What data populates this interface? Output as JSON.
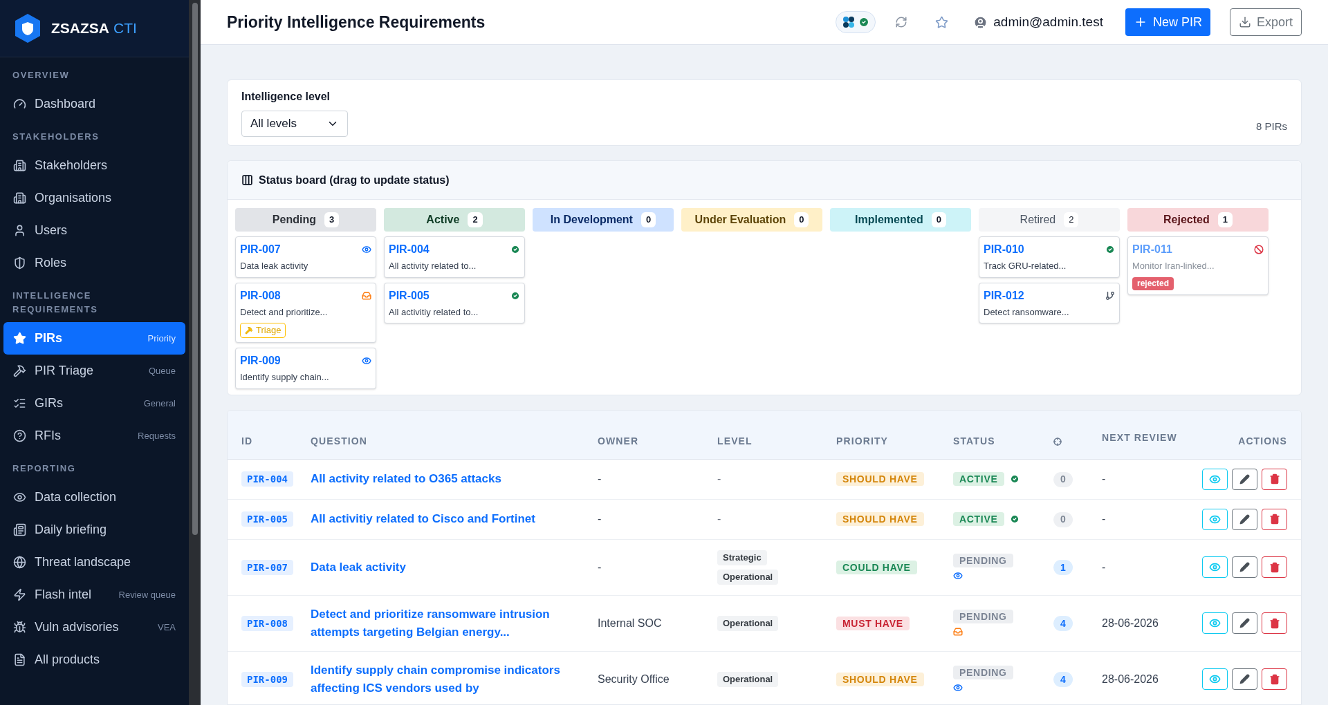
{
  "sidebar": {
    "brand": {
      "name": "ZSAZSA",
      "suffix": "CTI"
    },
    "sections": [
      {
        "title": "OVERVIEW",
        "items": [
          {
            "label": "Dashboard",
            "kind": "gauge",
            "selected": false
          }
        ]
      },
      {
        "title": "STAKEHOLDERS",
        "items": [
          {
            "label": "Stakeholders",
            "kind": "building",
            "selected": false
          },
          {
            "label": "Organisations",
            "kind": "building",
            "selected": false
          },
          {
            "label": "Users",
            "kind": "user",
            "selected": false
          },
          {
            "label": "Roles",
            "kind": "shield",
            "selected": false
          }
        ]
      },
      {
        "title": "INTELLIGENCE REQUIREMENTS",
        "items": [
          {
            "label": "PIRs",
            "hint": "Priority",
            "kind": "star",
            "selected": true
          },
          {
            "label": "PIR Triage",
            "hint": "Queue",
            "kind": "hammer",
            "selected": false
          },
          {
            "label": "GIRs",
            "hint": "General",
            "kind": "list",
            "selected": false
          },
          {
            "label": "RFIs",
            "hint": "Requests",
            "kind": "help",
            "selected": false
          }
        ]
      },
      {
        "title": "REPORTING",
        "items": [
          {
            "label": "Data collection",
            "kind": "eye",
            "selected": false
          },
          {
            "label": "Daily briefing",
            "kind": "news",
            "selected": false
          },
          {
            "label": "Threat landscape",
            "kind": "globe",
            "selected": false
          },
          {
            "label": "Flash intel",
            "hint": "Review queue",
            "kind": "zap",
            "selected": false
          },
          {
            "label": "Vuln advisories",
            "hint": "VEA",
            "kind": "bug",
            "selected": false
          },
          {
            "label": "All products",
            "kind": "file",
            "selected": false
          }
        ]
      }
    ]
  },
  "header": {
    "title": "Priority Intelligence Requirements",
    "user": "admin@admin.test",
    "buttons": [
      {
        "label": "New PIR",
        "kind": "primary"
      },
      {
        "label": "Export",
        "kind": "outline"
      }
    ]
  },
  "filter": {
    "label": "Intelligence level",
    "value": "All levels",
    "count": "8 PIRs"
  },
  "board": {
    "title": "Status board (drag to update status)",
    "columns": [
      {
        "title": "Pending",
        "count": "3",
        "kind": "pending",
        "cards": [
          {
            "id": "PIR-007",
            "text": "Data leak activity",
            "kind": "eye"
          },
          {
            "id": "PIR-008",
            "text": "Detect and prioritize...",
            "kind": "inbox",
            "tag": {
              "label": "Triage",
              "kind": "triage"
            }
          },
          {
            "id": "PIR-009",
            "text": "Identify supply chain...",
            "kind": "eye"
          }
        ]
      },
      {
        "title": "Active",
        "count": "2",
        "kind": "active",
        "cards": [
          {
            "id": "PIR-004",
            "text": "All activity related to...",
            "kind": "check"
          },
          {
            "id": "PIR-005",
            "text": "All activitiy related to...",
            "kind": "check"
          }
        ]
      },
      {
        "title": "In Development",
        "count": "0",
        "kind": "development"
      },
      {
        "title": "Under Evaluation",
        "count": "0",
        "kind": "evaluation"
      },
      {
        "title": "Implemented",
        "count": "0",
        "kind": "implemented"
      },
      {
        "title": "Retired",
        "count": "2",
        "kind": "retired",
        "cards": [
          {
            "id": "PIR-010",
            "text": "Track GRU-related...",
            "kind": "check"
          },
          {
            "id": "PIR-012",
            "text": "Detect ransomware...",
            "kind": "branch"
          }
        ]
      },
      {
        "title": "Rejected",
        "count": "1",
        "kind": "rejected",
        "cards": [
          {
            "id": "PIR-011",
            "text": "Monitor Iran-linked...",
            "kind": "ban",
            "faded": true,
            "tag": {
              "label": "rejected",
              "kind": "rejected"
            }
          }
        ]
      }
    ]
  },
  "table": {
    "columns": [
      "ID",
      "QUESTION",
      "OWNER",
      "LEVEL",
      "PRIORITY",
      "STATUS",
      "NEXT REVIEW",
      "ACTIONS"
    ],
    "rows": [
      {
        "kind": "check",
        "id": "PIR-004",
        "question": "All activity related to O365 attacks",
        "owner": "-",
        "level_empty": "-",
        "priority": {
          "label": "SHOULD HAVE",
          "kind": "should"
        },
        "status": {
          "label": "ACTIVE",
          "kind": "active"
        },
        "count": "0",
        "next_review": "-"
      },
      {
        "kind": "check",
        "id": "PIR-005",
        "question": "All activitiy related to Cisco and Fortinet",
        "owner": "-",
        "level_empty": "-",
        "priority": {
          "label": "SHOULD HAVE",
          "kind": "should"
        },
        "status": {
          "label": "ACTIVE",
          "kind": "active"
        },
        "count": "0",
        "next_review": "-"
      },
      {
        "kind": "eye",
        "id": "PIR-007",
        "question": "Data leak activity",
        "owner": "-",
        "levels": [
          "Strategic",
          "Operational"
        ],
        "priority": {
          "label": "COULD HAVE",
          "kind": "could"
        },
        "status": {
          "label": "PENDING",
          "kind": "pending"
        },
        "count": "1",
        "next_review": "-"
      },
      {
        "kind": "inbox",
        "id": "PIR-008",
        "question": "Detect and prioritize ransomware intrusion attempts targeting Belgian energy...",
        "owner": "Internal SOC",
        "levels": [
          "Operational"
        ],
        "priority": {
          "label": "MUST HAVE",
          "kind": "must"
        },
        "status": {
          "label": "PENDING",
          "kind": "pending"
        },
        "count": "4",
        "next_review": "28-06-2026"
      },
      {
        "kind": "eye",
        "id": "PIR-009",
        "question": "Identify supply chain compromise indicators affecting ICS vendors used by",
        "owner": "Security Office",
        "levels": [
          "Operational"
        ],
        "priority": {
          "label": "SHOULD HAVE",
          "kind": "should"
        },
        "status": {
          "label": "PENDING",
          "kind": "pending"
        },
        "count": "4",
        "next_review": "28-06-2026"
      }
    ]
  }
}
